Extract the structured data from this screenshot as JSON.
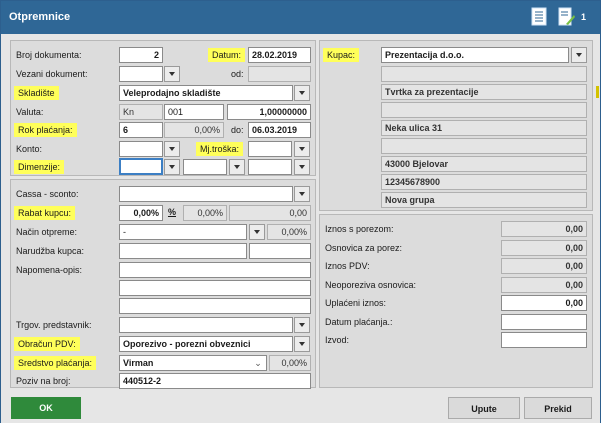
{
  "window": {
    "title": "Otpremnice",
    "badge": "1"
  },
  "left": {
    "broj_dokumenta": {
      "label": "Broj dokumenta:",
      "value": "2"
    },
    "datum": {
      "label": "Datum:",
      "value": "28.02.2019"
    },
    "vezani": {
      "label": "Vezani dokument:",
      "od_label": "od:"
    },
    "skladiste": {
      "label": "Skladište",
      "value": "Veleprodajno skladište"
    },
    "valuta": {
      "label": "Valuta:",
      "code": "Kn",
      "num": "001",
      "rate": "1,00000000"
    },
    "rok": {
      "label": "Rok plaćanja:",
      "days": "6",
      "pct": "0,00%",
      "do_label": "do:",
      "date": "06.03.2019"
    },
    "konto": {
      "label": "Konto:",
      "mj_label": "Mj.troška:"
    },
    "dimenzije": {
      "label": "Dimenzije:"
    },
    "cassa": {
      "label": "Cassa - sconto:"
    },
    "rabat": {
      "label": "Rabat kupcu:",
      "pct": "0,00%",
      "pct_sign": "%",
      "pct2": "0,00%",
      "value": "0,00"
    },
    "nacin": {
      "label": "Način otpreme:",
      "value": "-",
      "pct": "0,00%"
    },
    "narudzba": {
      "label": "Narudžba kupca:"
    },
    "napomena": {
      "label": "Napomena-opis:"
    },
    "trgov": {
      "label": "Trgov. predstavnik:"
    },
    "obracun": {
      "label": "Obračun PDV:",
      "value": "Oporezivo - porezni obveznici"
    },
    "sredstvo": {
      "label": "Sredstvo plaćanja:",
      "value": "Virman",
      "pct": "0,00%"
    },
    "poziv": {
      "label": "Poziv na broj:",
      "value": "440512-2"
    }
  },
  "right": {
    "kupac": {
      "label": "Kupac:",
      "value": "Prezentacija d.o.o."
    },
    "lines": [
      "",
      "Tvrtka za prezentacije",
      "",
      "Neka ulica 31",
      "",
      "43000 Bjelovar",
      "12345678900",
      "Nova grupa"
    ],
    "totals": [
      {
        "label": "Iznos s porezom:",
        "value": "0,00"
      },
      {
        "label": "Osnovica za porez:",
        "value": "0,00"
      },
      {
        "label": "Iznos PDV:",
        "value": "0,00"
      },
      {
        "label": "Neoporeziva osnovica:",
        "value": "0,00"
      },
      {
        "label": "Uplaćeni iznos:",
        "value": "0,00"
      },
      {
        "label": "Datum plaćanja.:",
        "value": ""
      },
      {
        "label": "Izvod:",
        "value": ""
      }
    ]
  },
  "buttons": {
    "ok": "OK",
    "upute": "Upute",
    "prekid": "Prekid"
  },
  "colors": {
    "titlebar": "#2f6796",
    "highlight": "#ffff5a",
    "ok": "#2f8a3b"
  }
}
